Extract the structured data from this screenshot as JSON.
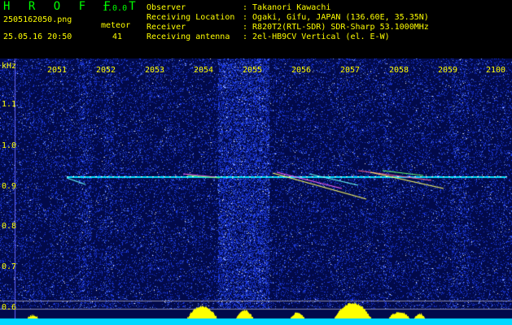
{
  "app": {
    "title": "H R O F F T",
    "version": "1.0.0"
  },
  "file": {
    "name": "2505162050.png",
    "timestamp": "25.05.16 20:50"
  },
  "meteor": {
    "label": "meteor",
    "count": "41"
  },
  "info": [
    {
      "key": "Observer",
      "value": ": Takanori Kawachi"
    },
    {
      "key": "Receiving Location",
      "value": ": Ogaki, Gifu, JAPAN (136.60E, 35.35N)"
    },
    {
      "key": "Receiver",
      "value": ": R820T2(RTL-SDR) SDR-Sharp 53.1000MHz"
    },
    {
      "key": "Receiving antenna",
      "value": ": 2el-HB9CV Vertical (el. E-W)"
    }
  ],
  "axis": {
    "y_unit": "kHz",
    "x_ticks": [
      "2051",
      "2052",
      "2053",
      "2054",
      "2055",
      "2056",
      "2057",
      "2058",
      "2059",
      "2100"
    ],
    "y_ticks": [
      "1.1",
      "1.0",
      "0.9",
      "0.8",
      "0.7",
      "0.6"
    ]
  },
  "colors": {
    "background": "#000000",
    "label_yellow": "#ffff00",
    "title_green": "#00ff00",
    "noise_blue": "#0a1a8c",
    "carrier_cyan": "#00ffff",
    "level_yellow": "#ffff00"
  }
}
